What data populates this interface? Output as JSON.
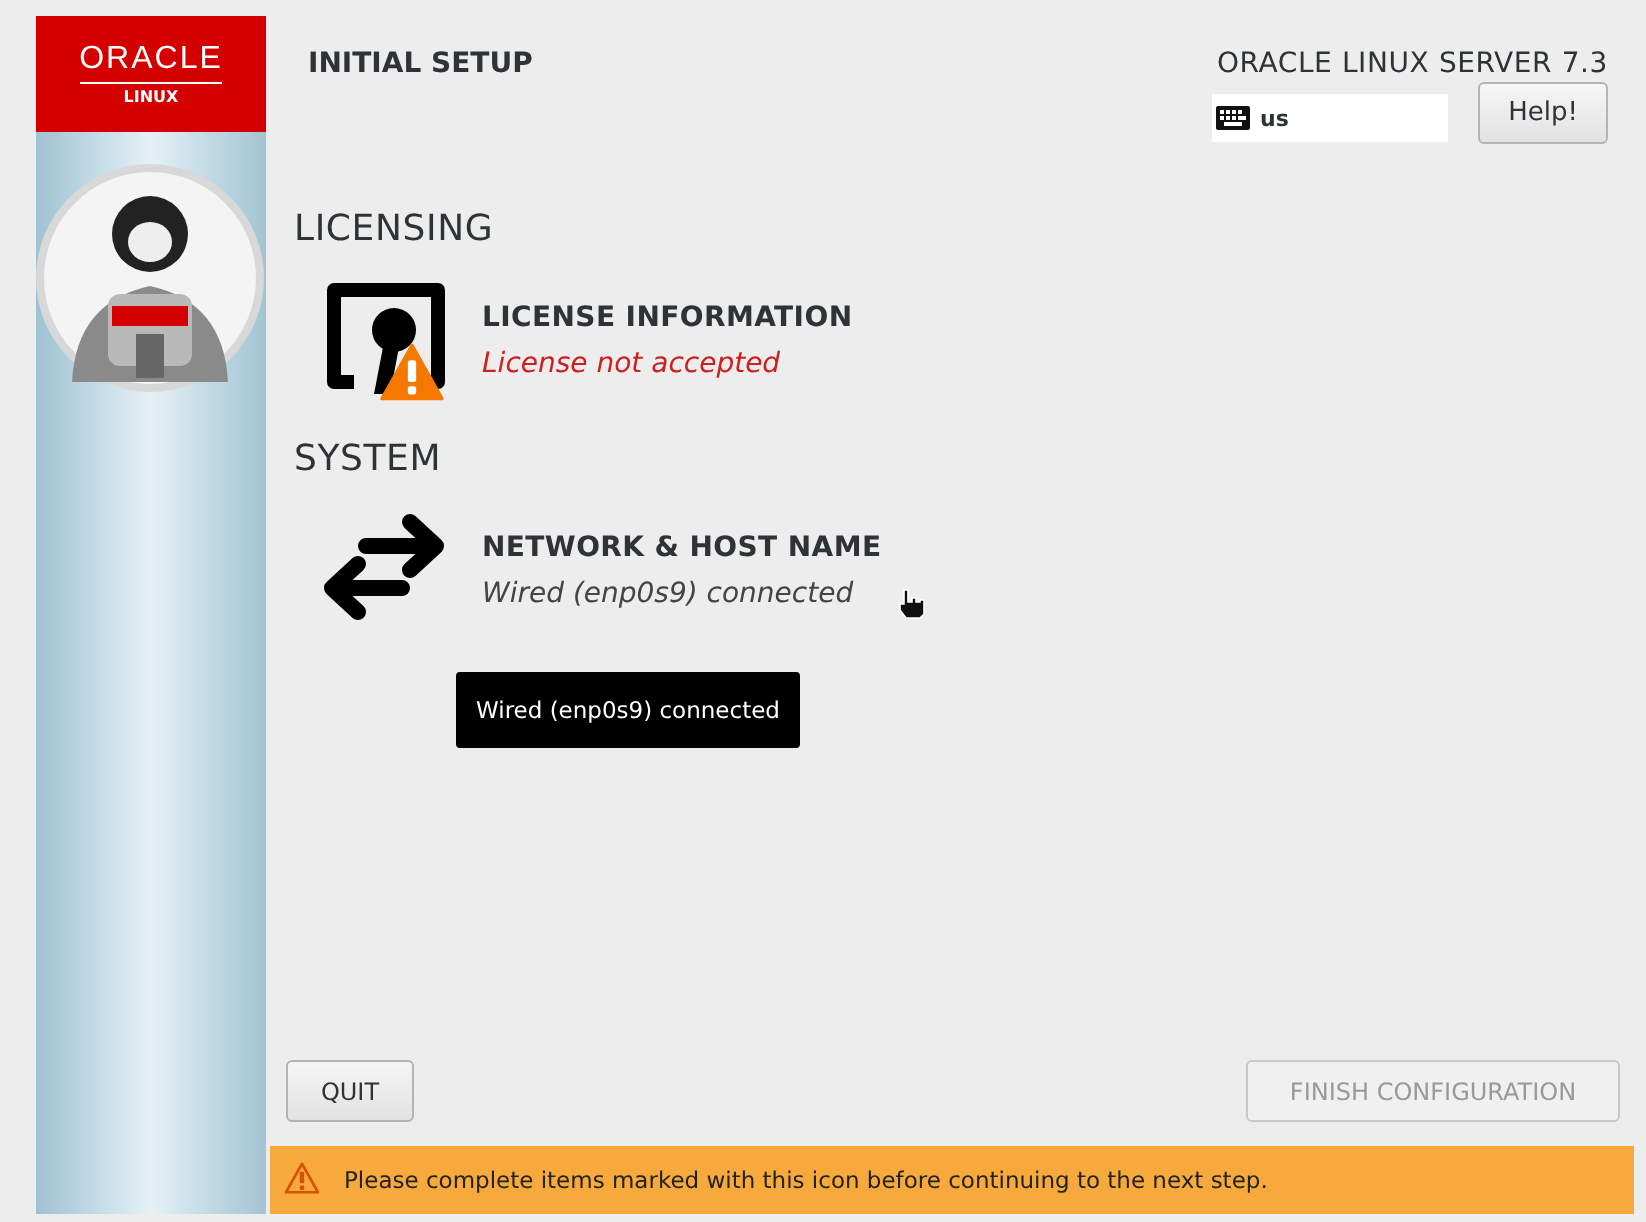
{
  "sidebar": {
    "logo": {
      "brand": "ORACLE",
      "product": "LINUX"
    }
  },
  "header": {
    "title": "INITIAL SETUP",
    "product": "ORACLE LINUX SERVER 7.3",
    "keyboard_layout": "us",
    "help_button": "Help!"
  },
  "sections": [
    {
      "title": "LICENSING",
      "spokes": [
        {
          "kind": "license",
          "title": "LICENSE INFORMATION",
          "status": "License not accepted",
          "warning": true
        }
      ]
    },
    {
      "title": "SYSTEM",
      "spokes": [
        {
          "kind": "network",
          "title": "NETWORK & HOST NAME",
          "status": "Wired (enp0s9) connected",
          "warning": false
        }
      ]
    }
  ],
  "tooltip": "Wired (enp0s9) connected",
  "buttons": {
    "quit": {
      "label": "QUIT",
      "disabled": false
    },
    "finish": {
      "label": "FINISH CONFIGURATION",
      "disabled": true
    }
  },
  "warning_bar": "Please complete items marked with this icon before continuing to the next step."
}
